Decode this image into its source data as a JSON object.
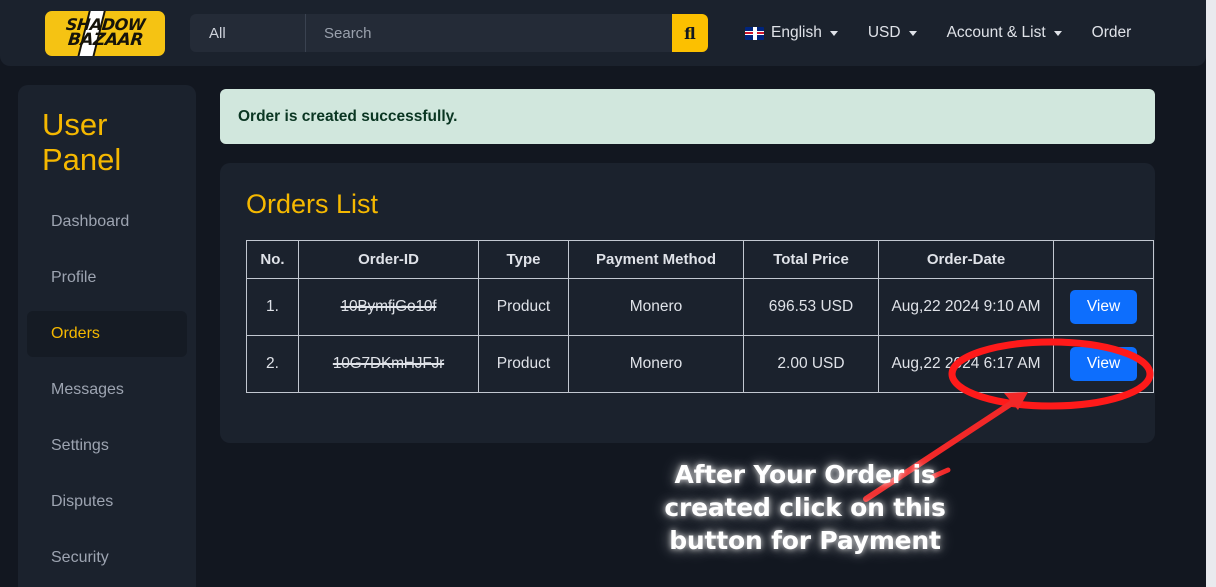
{
  "navbar": {
    "logo": {
      "name": "shadow-bazaar-logo",
      "line1": "SHADOW",
      "line2": "BAZAAR",
      "bg_color": "#f5c313"
    },
    "search": {
      "category": "All",
      "placeholder": "Search",
      "value": "",
      "button_icon": "search-icon",
      "button_glyph": "fl",
      "button_color": "#fcc000"
    },
    "items": [
      {
        "label": "English",
        "icon": "uk-flag-icon",
        "has_caret": true
      },
      {
        "label": "USD",
        "icon": "",
        "has_caret": true
      },
      {
        "label": "Account & List",
        "icon": "",
        "has_caret": true
      },
      {
        "label": "Order",
        "icon": "",
        "has_caret": false
      }
    ]
  },
  "sidebar": {
    "title": "User Panel",
    "title_color": "#f5b800",
    "items": [
      {
        "label": "Dashboard",
        "active": false
      },
      {
        "label": "Profile",
        "active": false
      },
      {
        "label": "Orders",
        "active": true
      },
      {
        "label": "Messages",
        "active": false
      },
      {
        "label": "Settings",
        "active": false
      },
      {
        "label": "Disputes",
        "active": false
      },
      {
        "label": "Security",
        "active": false
      }
    ]
  },
  "alert": {
    "message": "Order is created successfully.",
    "bg_color": "#d1e7dd",
    "text_color": "#0a3622"
  },
  "orders_card": {
    "title": "Orders List",
    "title_color": "#f5b800",
    "columns": [
      "No.",
      "Order-ID",
      "Type",
      "Payment Method",
      "Total Price",
      "Order-Date",
      ""
    ],
    "rows": [
      {
        "no": "1.",
        "order_id": "10BymfjGo10f",
        "order_id_struck": true,
        "type": "Product",
        "payment_method": "Monero",
        "total_price": "696.53 USD",
        "order_date": "Aug,22 2024 9:10 AM",
        "action_label": "View",
        "highlighted": false
      },
      {
        "no": "2.",
        "order_id": "10G7DKmHJFJr",
        "order_id_struck": true,
        "type": "Product",
        "payment_method": "Monero",
        "total_price": "2.00 USD",
        "order_date": "Aug,22 2024 6:17 AM",
        "action_label": "View",
        "highlighted": true
      }
    ],
    "action_button_color": "#0d6efd"
  },
  "annotation": {
    "text_line1": "After Your Order is",
    "text_line2": "created click on this",
    "text_line3": "button for Payment",
    "color": "#ffffff",
    "marker_color": "#ff1a1a",
    "shape": "ellipse-around-view-button-with-arrow"
  }
}
